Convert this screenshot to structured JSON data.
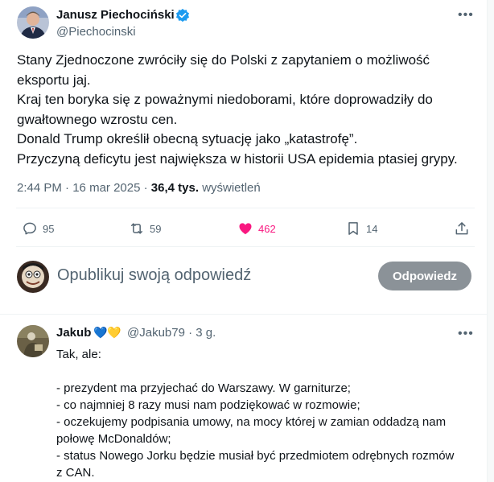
{
  "tweet": {
    "author": {
      "name": "Janusz Piechociński",
      "handle": "@Piechocinski"
    },
    "text_lines": [
      "Stany Zjednoczone zwróciły się do Polski z zapytaniem o możliwość",
      "eksportu jaj.",
      "Kraj ten boryka się z poważnymi niedoborami, które doprowadziły do",
      "gwałtownego wzrostu cen.",
      "Donald Trump określił obecną sytuację jako „katastrofę”.",
      "Przyczyną deficytu jest największa w historii USA epidemia ptasiej grypy."
    ],
    "meta": {
      "time": "2:44 PM",
      "date": "16 mar 2025",
      "views_count": "36,4 tys.",
      "views_label": "wyświetleń"
    },
    "actions": {
      "replies": "95",
      "reposts": "59",
      "likes": "462",
      "bookmarks": "14"
    },
    "colors": {
      "like": "#f91880",
      "verified": "#1d9bf0",
      "secondary_text": "#536471"
    }
  },
  "composer": {
    "placeholder": "Opublikuj swoją odpowiedź",
    "button_label": "Odpowiedz"
  },
  "reply": {
    "name": "Jakub",
    "badges": "💙💛",
    "handle": "@Jakub79",
    "time": "3 g.",
    "lines": [
      "Tak, ale:",
      "",
      "- prezydent ma przyjechać do Warszawy. W garniturze;",
      "- co najmniej 8 razy musi nam podziękować w rozmowie;",
      "- oczekujemy podpisania umowy, na mocy której w zamian oddadzą nam",
      "połowę McDonaldów;",
      "- status Nowego Jorku będzie musiał być przedmiotem odrębnych rozmów",
      "z CAN."
    ]
  },
  "icons": {
    "more": "more-icon",
    "verified": "verified-badge-icon",
    "reply": "reply-icon",
    "repost": "repost-icon",
    "like": "heart-icon",
    "bookmark": "bookmark-icon",
    "share": "share-icon"
  }
}
